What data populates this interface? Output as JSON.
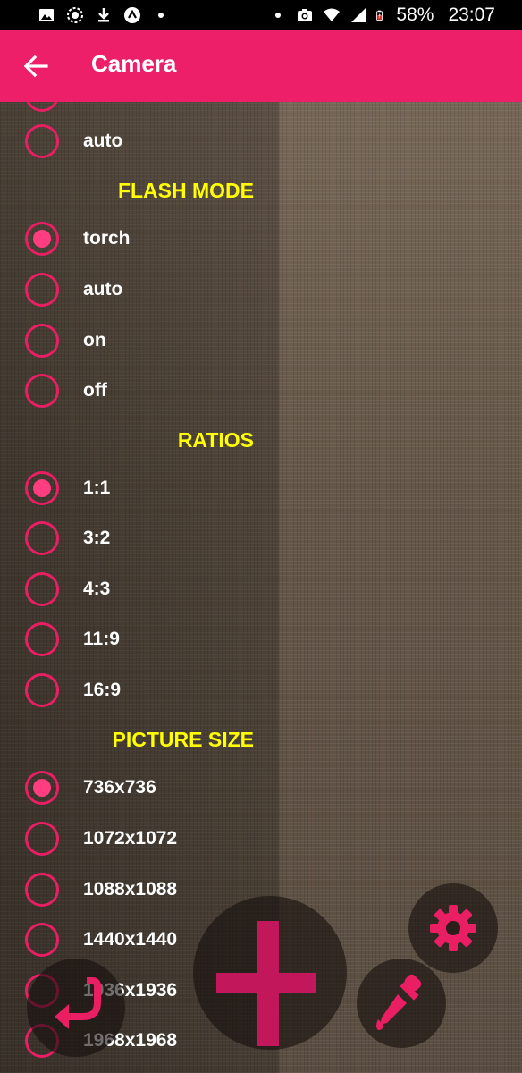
{
  "status_bar": {
    "battery": "58%",
    "time": "23:07",
    "icons": [
      "image-icon",
      "messenger-icon",
      "download-icon",
      "app-icon",
      "dot-icon",
      "camera-icon",
      "wifi-icon",
      "signal-icon",
      "battery-icon"
    ]
  },
  "app_bar": {
    "title": "Camera",
    "back_icon": "arrow-left-icon"
  },
  "settings": {
    "top_option": {
      "label": "auto",
      "checked": false
    },
    "flash_mode": {
      "heading": "FLASH MODE",
      "options": [
        {
          "label": "torch",
          "checked": true
        },
        {
          "label": "auto",
          "checked": false
        },
        {
          "label": "on",
          "checked": false
        },
        {
          "label": "off",
          "checked": false
        }
      ]
    },
    "ratios": {
      "heading": "RATIOS",
      "options": [
        {
          "label": "1:1",
          "checked": true
        },
        {
          "label": "3:2",
          "checked": false
        },
        {
          "label": "4:3",
          "checked": false
        },
        {
          "label": "11:9",
          "checked": false
        },
        {
          "label": "16:9",
          "checked": false
        }
      ]
    },
    "picture_size": {
      "heading": "PICTURE SIZE",
      "options": [
        {
          "label": "736x736",
          "checked": true
        },
        {
          "label": "1072x1072",
          "checked": false
        },
        {
          "label": "1088x1088",
          "checked": false
        },
        {
          "label": "1440x1440",
          "checked": false
        },
        {
          "label": "1936x1936",
          "checked": false
        },
        {
          "label": "1968x1968",
          "checked": false
        }
      ]
    }
  },
  "fabs": {
    "add_icon": "plus-icon",
    "settings_icon": "gear-icon",
    "picker_icon": "eyedropper-icon",
    "undo_icon": "undo-icon"
  },
  "colors": {
    "accent": "#ed1f68",
    "radio": "#e91e63",
    "heading": "#ffff00"
  }
}
